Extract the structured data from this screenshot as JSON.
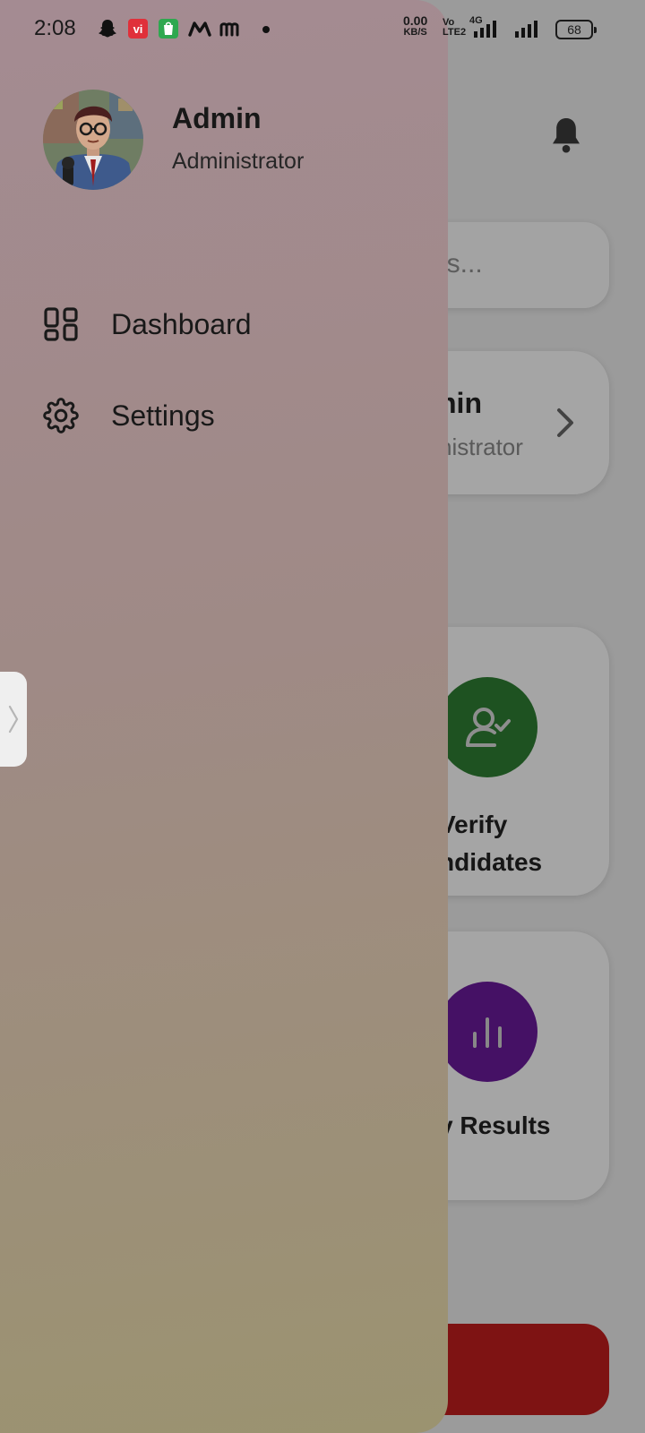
{
  "status_bar": {
    "time": "2:08",
    "net_speed_value": "0.00",
    "net_speed_unit": "KB/S",
    "volte_top": "Vo",
    "volte_bottom": "LTE2",
    "network_label": "4G",
    "battery": "68",
    "notification_icons": [
      "snapchat-icon",
      "vi-icon",
      "shop-icon",
      "m-icon",
      "m-icon",
      "dot-icon"
    ]
  },
  "background_screen": {
    "search_placeholder_fragment": "es...",
    "profile_card": {
      "name_fragment": "nin",
      "role_fragment": "nistrator"
    },
    "cards": [
      {
        "label_line1": "Verify",
        "label_line2": "ndidates",
        "icon": "user-check-icon",
        "color": "#2e7d32"
      },
      {
        "label_line1": "v Results",
        "label_line2": "",
        "icon": "bar-chart-icon",
        "color": "#6a1b9a"
      }
    ],
    "bottom_button_color": "#bf1e1e"
  },
  "drawer": {
    "profile": {
      "name": "Admin",
      "role": "Administrator"
    },
    "menu": [
      {
        "label": "Dashboard",
        "icon": "dashboard-grid-icon"
      },
      {
        "label": "Settings",
        "icon": "gear-icon"
      }
    ]
  }
}
